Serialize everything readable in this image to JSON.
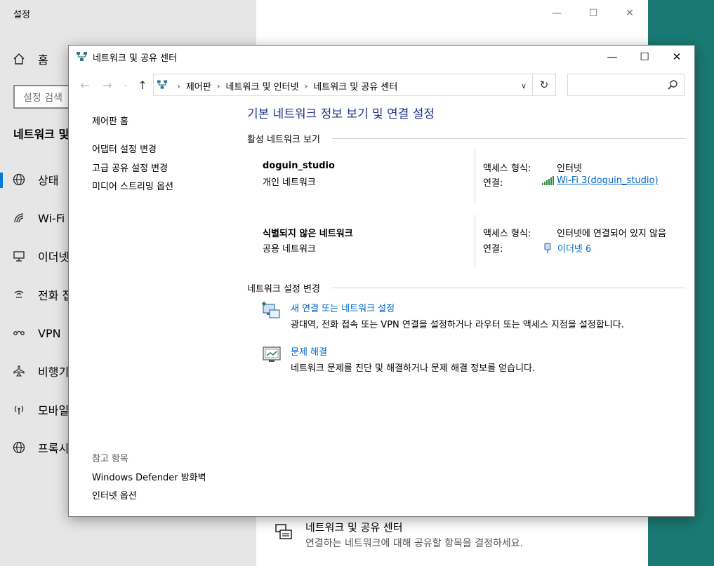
{
  "settings": {
    "title": "설정",
    "search_placeholder": "설정 검색",
    "section_title": "네트워크 및",
    "nav": [
      {
        "icon": "home-icon",
        "label": "홈"
      },
      {
        "icon": "globe-icon",
        "label": "상태"
      },
      {
        "icon": "wifi-icon",
        "label": "Wi-Fi"
      },
      {
        "icon": "ethernet-icon",
        "label": "이더넷"
      },
      {
        "icon": "dialup-icon",
        "label": "전화 접"
      },
      {
        "icon": "vpn-icon",
        "label": "VPN"
      },
      {
        "icon": "airplane-icon",
        "label": "비행기"
      },
      {
        "icon": "hotspot-icon",
        "label": "모바일"
      },
      {
        "icon": "proxy-globe-icon",
        "label": "프록시"
      }
    ],
    "bottom_item": {
      "title": "네트워크 및 공유 센터",
      "description": "연결하는 네트워크에 대해 공유할 항목을 결정하세요."
    }
  },
  "nsc": {
    "title": "네트워크 및 공유 센터",
    "breadcrumbs": [
      "제어판",
      "네트워크 및 인터넷",
      "네트워크 및 공유 센터"
    ],
    "left_pane": {
      "home": "제어판 홈",
      "links": [
        "어댑터 설정 변경",
        "고급 공유 설정 변경",
        "미디어 스트리밍 옵션"
      ],
      "see_also_heading": "참고 항목",
      "see_also": [
        "Windows Defender 방화벽",
        "인터넷 옵션"
      ]
    },
    "main_title": "기본 네트워크 정보 보기 및 연결 설정",
    "active_networks_heading": "활성 네트워크 보기",
    "networks": [
      {
        "name": "doguin_studio",
        "type": "개인 네트워크",
        "access_label": "액세스 형식:",
        "access_value": "인터넷",
        "conn_label": "연결:",
        "conn_value": "Wi-Fi 3(doguin_studio)"
      },
      {
        "name": "식별되지 않은 네트워크",
        "type": "공용 네트워크",
        "access_label": "액세스 형식:",
        "access_value": "인터넷에 연결되어 있지 않음",
        "conn_label": "연결:",
        "conn_value": "이더넷 6"
      }
    ],
    "change_settings_heading": "네트워크 설정 변경",
    "tasks": [
      {
        "title": "새 연결 또는 네트워크 설정",
        "description": "광대역, 전화 접속 또는 VPN 연결을 설정하거나 라우터 또는 액세스 지점을 설정합니다."
      },
      {
        "title": "문제 해결",
        "description": "네트워크 문제를 진단 및 해결하거나 문제 해결 정보를 얻습니다."
      }
    ]
  },
  "colors": {
    "accent": "#0078d7",
    "link": "#0066cc",
    "title_blue": "#1e3287",
    "desktop": "#1a7a73"
  }
}
